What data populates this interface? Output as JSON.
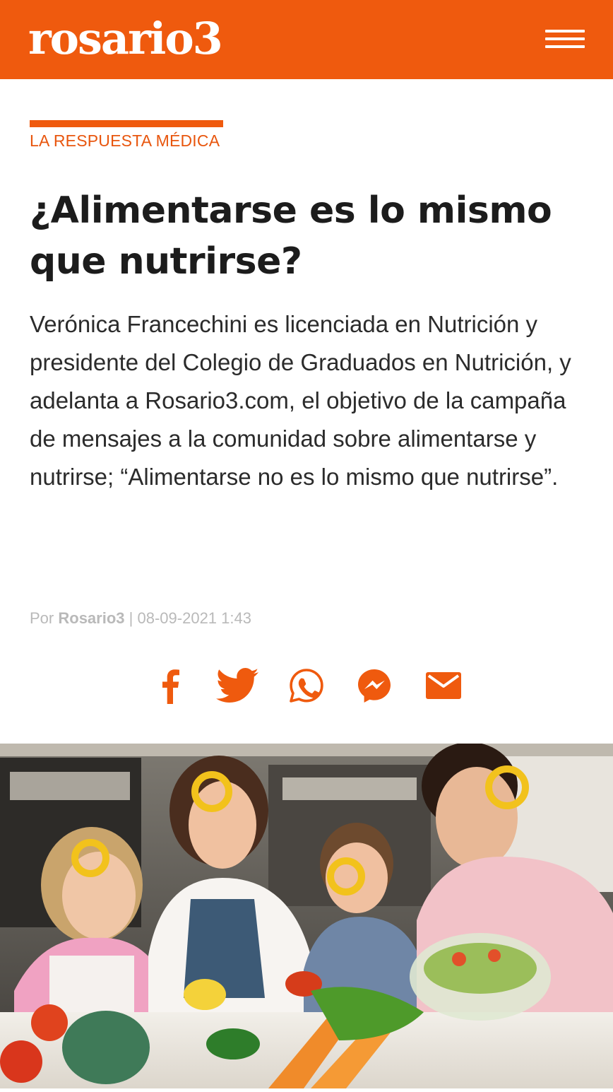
{
  "header": {
    "logo": "rosario3",
    "menu_icon": "hamburger-menu-icon",
    "brand_color": "#ef5a0e"
  },
  "article": {
    "section": "LA RESPUESTA MÉDICA",
    "title": "¿Alimentarse es lo mismo que nutrirse?",
    "summary": "Verónica Francechini es licenciada en Nutrición y presidente del Colegio de Graduados en Nutrición, y adelanta a Rosario3.com, el objetivo de la campaña de mensajes a la comunidad sobre alimentarse y nutrirse; “Alimentarse no es lo mismo que nutrirse”.",
    "byline": {
      "prefix": "Por",
      "author": "Rosario3",
      "separator": "|",
      "date": "08-09-2021 1:43"
    }
  },
  "share": [
    {
      "icon": "facebook-icon"
    },
    {
      "icon": "twitter-icon"
    },
    {
      "icon": "whatsapp-icon"
    },
    {
      "icon": "messenger-icon"
    },
    {
      "icon": "email-icon"
    }
  ],
  "hero_image": {
    "subject": "family-with-vegetables-photo"
  }
}
